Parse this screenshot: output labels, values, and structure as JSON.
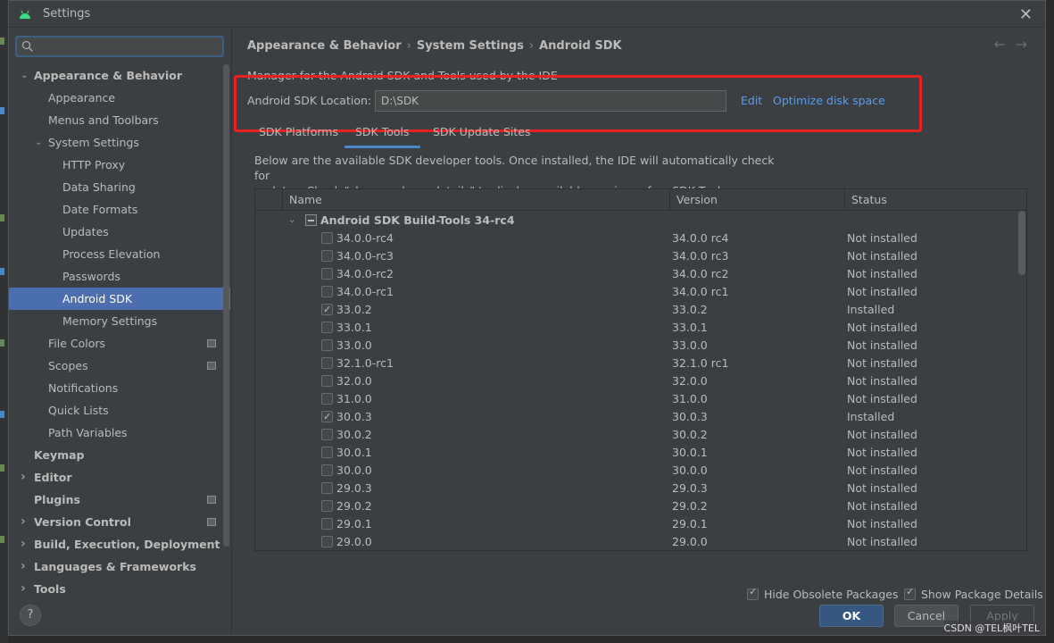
{
  "window": {
    "title": "Settings"
  },
  "search": {
    "placeholder": "Q-"
  },
  "sidebar": {
    "items": [
      {
        "label": "Appearance & Behavior",
        "expanded": true
      },
      {
        "label": "Appearance"
      },
      {
        "label": "Menus and Toolbars"
      },
      {
        "label": "System Settings",
        "expanded": true
      },
      {
        "label": "HTTP Proxy"
      },
      {
        "label": "Data Sharing"
      },
      {
        "label": "Date Formats"
      },
      {
        "label": "Updates"
      },
      {
        "label": "Process Elevation"
      },
      {
        "label": "Passwords"
      },
      {
        "label": "Android SDK",
        "selected": true
      },
      {
        "label": "Memory Settings"
      },
      {
        "label": "File Colors"
      },
      {
        "label": "Scopes"
      },
      {
        "label": "Notifications"
      },
      {
        "label": "Quick Lists"
      },
      {
        "label": "Path Variables"
      },
      {
        "label": "Keymap"
      },
      {
        "label": "Editor"
      },
      {
        "label": "Plugins"
      },
      {
        "label": "Version Control"
      },
      {
        "label": "Build, Execution, Deployment"
      },
      {
        "label": "Languages & Frameworks"
      },
      {
        "label": "Tools"
      }
    ]
  },
  "breadcrumb": [
    "Appearance & Behavior",
    "System Settings",
    "Android SDK"
  ],
  "main": {
    "description": "Manager for the Android SDK and Tools used by the IDE",
    "sdk_location_label": "Android SDK Location:",
    "sdk_location_value": "D:\\SDK",
    "edit_label": "Edit",
    "optimize_label": "Optimize disk space",
    "tabs": [
      "SDK Platforms",
      "SDK Tools",
      "SDK Update Sites"
    ],
    "active_tab": "SDK Tools",
    "tools_description_line1": "Below are the available SDK developer tools. Once installed, the IDE will automatically check for",
    "tools_description_line2": "updates. Check \"show package details\" to display available versions of an SDK Tool."
  },
  "table": {
    "headers": [
      "Name",
      "Version",
      "Status"
    ],
    "group": "Android SDK Build-Tools 34-rc4",
    "rows": [
      {
        "name": "34.0.0-rc4",
        "version": "34.0.0 rc4",
        "status": "Not installed",
        "checked": false
      },
      {
        "name": "34.0.0-rc3",
        "version": "34.0.0 rc3",
        "status": "Not installed",
        "checked": false
      },
      {
        "name": "34.0.0-rc2",
        "version": "34.0.0 rc2",
        "status": "Not installed",
        "checked": false
      },
      {
        "name": "34.0.0-rc1",
        "version": "34.0.0 rc1",
        "status": "Not installed",
        "checked": false
      },
      {
        "name": "33.0.2",
        "version": "33.0.2",
        "status": "Installed",
        "checked": true
      },
      {
        "name": "33.0.1",
        "version": "33.0.1",
        "status": "Not installed",
        "checked": false
      },
      {
        "name": "33.0.0",
        "version": "33.0.0",
        "status": "Not installed",
        "checked": false
      },
      {
        "name": "32.1.0-rc1",
        "version": "32.1.0 rc1",
        "status": "Not installed",
        "checked": false
      },
      {
        "name": "32.0.0",
        "version": "32.0.0",
        "status": "Not installed",
        "checked": false
      },
      {
        "name": "31.0.0",
        "version": "31.0.0",
        "status": "Not installed",
        "checked": false
      },
      {
        "name": "30.0.3",
        "version": "30.0.3",
        "status": "Installed",
        "checked": true
      },
      {
        "name": "30.0.2",
        "version": "30.0.2",
        "status": "Not installed",
        "checked": false
      },
      {
        "name": "30.0.1",
        "version": "30.0.1",
        "status": "Not installed",
        "checked": false
      },
      {
        "name": "30.0.0",
        "version": "30.0.0",
        "status": "Not installed",
        "checked": false
      },
      {
        "name": "29.0.3",
        "version": "29.0.3",
        "status": "Not installed",
        "checked": false
      },
      {
        "name": "29.0.2",
        "version": "29.0.2",
        "status": "Not installed",
        "checked": false
      },
      {
        "name": "29.0.1",
        "version": "29.0.1",
        "status": "Not installed",
        "checked": false
      },
      {
        "name": "29.0.0",
        "version": "29.0.0",
        "status": "Not installed",
        "checked": false
      }
    ]
  },
  "options": {
    "hide_obsolete": "Hide Obsolete Packages",
    "show_details": "Show Package Details"
  },
  "buttons": {
    "ok": "OK",
    "cancel": "Cancel",
    "apply": "Apply",
    "help": "?"
  },
  "watermark": "CSDN @TEL枫叶TEL",
  "colors": {
    "accent": "#4b6eaf",
    "link": "#589df6",
    "highlight_box": "#e8221f"
  }
}
